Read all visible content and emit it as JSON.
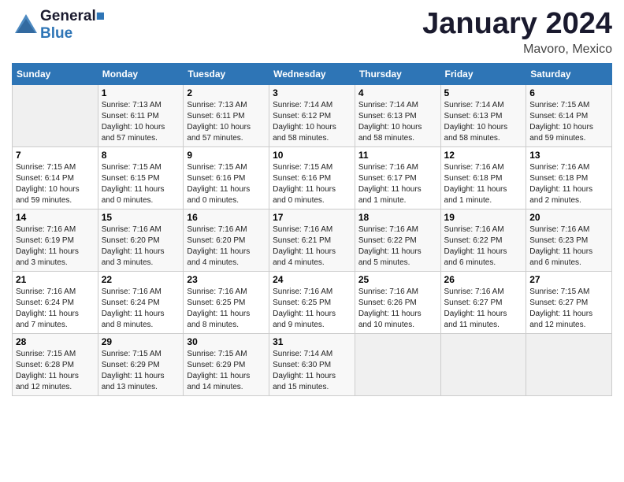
{
  "header": {
    "logo_line1": "General",
    "logo_line2": "Blue",
    "month": "January 2024",
    "location": "Mavoro, Mexico"
  },
  "weekdays": [
    "Sunday",
    "Monday",
    "Tuesday",
    "Wednesday",
    "Thursday",
    "Friday",
    "Saturday"
  ],
  "weeks": [
    [
      {
        "day": "",
        "info": ""
      },
      {
        "day": "1",
        "info": "Sunrise: 7:13 AM\nSunset: 6:11 PM\nDaylight: 10 hours\nand 57 minutes."
      },
      {
        "day": "2",
        "info": "Sunrise: 7:13 AM\nSunset: 6:11 PM\nDaylight: 10 hours\nand 57 minutes."
      },
      {
        "day": "3",
        "info": "Sunrise: 7:14 AM\nSunset: 6:12 PM\nDaylight: 10 hours\nand 58 minutes."
      },
      {
        "day": "4",
        "info": "Sunrise: 7:14 AM\nSunset: 6:13 PM\nDaylight: 10 hours\nand 58 minutes."
      },
      {
        "day": "5",
        "info": "Sunrise: 7:14 AM\nSunset: 6:13 PM\nDaylight: 10 hours\nand 58 minutes."
      },
      {
        "day": "6",
        "info": "Sunrise: 7:15 AM\nSunset: 6:14 PM\nDaylight: 10 hours\nand 59 minutes."
      }
    ],
    [
      {
        "day": "7",
        "info": "Sunrise: 7:15 AM\nSunset: 6:14 PM\nDaylight: 10 hours\nand 59 minutes."
      },
      {
        "day": "8",
        "info": "Sunrise: 7:15 AM\nSunset: 6:15 PM\nDaylight: 11 hours\nand 0 minutes."
      },
      {
        "day": "9",
        "info": "Sunrise: 7:15 AM\nSunset: 6:16 PM\nDaylight: 11 hours\nand 0 minutes."
      },
      {
        "day": "10",
        "info": "Sunrise: 7:15 AM\nSunset: 6:16 PM\nDaylight: 11 hours\nand 0 minutes."
      },
      {
        "day": "11",
        "info": "Sunrise: 7:16 AM\nSunset: 6:17 PM\nDaylight: 11 hours\nand 1 minute."
      },
      {
        "day": "12",
        "info": "Sunrise: 7:16 AM\nSunset: 6:18 PM\nDaylight: 11 hours\nand 1 minute."
      },
      {
        "day": "13",
        "info": "Sunrise: 7:16 AM\nSunset: 6:18 PM\nDaylight: 11 hours\nand 2 minutes."
      }
    ],
    [
      {
        "day": "14",
        "info": "Sunrise: 7:16 AM\nSunset: 6:19 PM\nDaylight: 11 hours\nand 3 minutes."
      },
      {
        "day": "15",
        "info": "Sunrise: 7:16 AM\nSunset: 6:20 PM\nDaylight: 11 hours\nand 3 minutes."
      },
      {
        "day": "16",
        "info": "Sunrise: 7:16 AM\nSunset: 6:20 PM\nDaylight: 11 hours\nand 4 minutes."
      },
      {
        "day": "17",
        "info": "Sunrise: 7:16 AM\nSunset: 6:21 PM\nDaylight: 11 hours\nand 4 minutes."
      },
      {
        "day": "18",
        "info": "Sunrise: 7:16 AM\nSunset: 6:22 PM\nDaylight: 11 hours\nand 5 minutes."
      },
      {
        "day": "19",
        "info": "Sunrise: 7:16 AM\nSunset: 6:22 PM\nDaylight: 11 hours\nand 6 minutes."
      },
      {
        "day": "20",
        "info": "Sunrise: 7:16 AM\nSunset: 6:23 PM\nDaylight: 11 hours\nand 6 minutes."
      }
    ],
    [
      {
        "day": "21",
        "info": "Sunrise: 7:16 AM\nSunset: 6:24 PM\nDaylight: 11 hours\nand 7 minutes."
      },
      {
        "day": "22",
        "info": "Sunrise: 7:16 AM\nSunset: 6:24 PM\nDaylight: 11 hours\nand 8 minutes."
      },
      {
        "day": "23",
        "info": "Sunrise: 7:16 AM\nSunset: 6:25 PM\nDaylight: 11 hours\nand 8 minutes."
      },
      {
        "day": "24",
        "info": "Sunrise: 7:16 AM\nSunset: 6:25 PM\nDaylight: 11 hours\nand 9 minutes."
      },
      {
        "day": "25",
        "info": "Sunrise: 7:16 AM\nSunset: 6:26 PM\nDaylight: 11 hours\nand 10 minutes."
      },
      {
        "day": "26",
        "info": "Sunrise: 7:16 AM\nSunset: 6:27 PM\nDaylight: 11 hours\nand 11 minutes."
      },
      {
        "day": "27",
        "info": "Sunrise: 7:15 AM\nSunset: 6:27 PM\nDaylight: 11 hours\nand 12 minutes."
      }
    ],
    [
      {
        "day": "28",
        "info": "Sunrise: 7:15 AM\nSunset: 6:28 PM\nDaylight: 11 hours\nand 12 minutes."
      },
      {
        "day": "29",
        "info": "Sunrise: 7:15 AM\nSunset: 6:29 PM\nDaylight: 11 hours\nand 13 minutes."
      },
      {
        "day": "30",
        "info": "Sunrise: 7:15 AM\nSunset: 6:29 PM\nDaylight: 11 hours\nand 14 minutes."
      },
      {
        "day": "31",
        "info": "Sunrise: 7:14 AM\nSunset: 6:30 PM\nDaylight: 11 hours\nand 15 minutes."
      },
      {
        "day": "",
        "info": ""
      },
      {
        "day": "",
        "info": ""
      },
      {
        "day": "",
        "info": ""
      }
    ]
  ]
}
